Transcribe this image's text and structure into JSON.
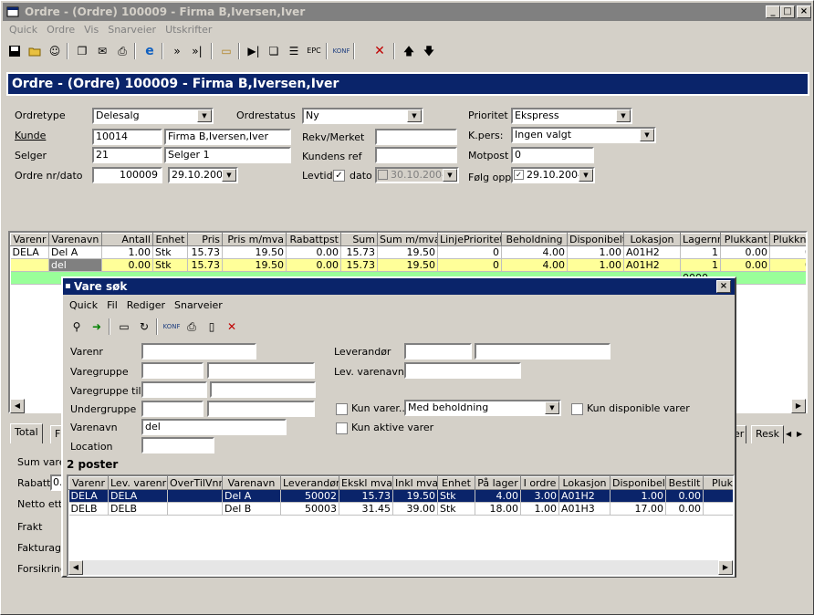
{
  "window": {
    "title": "Ordre -  (Ordre) 100009 - Firma B,Iversen,Iver",
    "banner": "Ordre -  (Ordre) 100009 - Firma B,Iversen,Iver",
    "caption_buttons": [
      "_",
      "□",
      "×"
    ]
  },
  "menu": [
    "Quick",
    "Ordre",
    "Vis",
    "Snarveier",
    "Utskrifter"
  ],
  "form": {
    "ordretype_label": "Ordretype",
    "ordretype_value": "Delesalg",
    "ordrestatus_label": "Ordrestatus",
    "ordrestatus_value": "Ny",
    "prioritet_label": "Prioritet",
    "prioritet_value": "Ekspress",
    "kunde_label": "Kunde",
    "kunde_nr": "10014",
    "kunde_navn": "Firma B,Iversen,Iver",
    "rekv_label": "Rekv/Merket",
    "rekv_value": "",
    "kpers_label": "K.pers:",
    "kpers_value": "Ingen valgt",
    "selger_label": "Selger",
    "selger_nr": "21",
    "selger_navn": "Selger 1",
    "kundensref_label": "Kundens ref",
    "kundensref_value": "",
    "motpost_label": "Motpost",
    "motpost_value": "0",
    "ordrenr_label": "Ordre nr/dato",
    "ordrenr_value": "100009",
    "ordredato_value": "29.10.2004",
    "levtid_label": "Levtid",
    "dato_label": "dato",
    "levtid_dato": "30.10.2004",
    "folgopp_label": "Følg opp",
    "folgopp_dato": "29.10.2004"
  },
  "order_grid": {
    "columns": [
      "Varenr",
      "Varenavn",
      "Antall",
      "Enhet",
      "Pris",
      "Pris m/mva",
      "Rabattpst",
      "Sum",
      "Sum m/mva",
      "LinjePrioritet",
      "Beholdning",
      "Disponibelt",
      "Lokasjon",
      "Lagernr",
      "Plukkant",
      "Plukknr"
    ],
    "rows": [
      [
        "DELA",
        "Del A",
        "1.00",
        "Stk",
        "15.73",
        "19.50",
        "0.00",
        "15.73",
        "19.50",
        "0",
        "4.00",
        "1.00",
        "A01H2",
        "1",
        "0.00",
        "0"
      ],
      [
        "",
        "del",
        "0.00",
        "Stk",
        "15.73",
        "19.50",
        "0.00",
        "15.73",
        "19.50",
        "0",
        "4.00",
        "1.00",
        "A01H2",
        "1",
        "0.00",
        "0"
      ]
    ],
    "partial_value": "0000"
  },
  "bottom_tabs": [
    "Total",
    "F"
  ],
  "right_tabs": [
    "er",
    "Resk"
  ],
  "totals": {
    "sum_label": "Sum varel",
    "rabatt_label": "Rabatt",
    "rabatt_value": "0.",
    "netto_label": "Netto ette",
    "frakt_label": "Frakt",
    "faktura_label": "Fakturage",
    "forsikring_label": "Forsikring"
  },
  "dialog": {
    "title": "Vare søk",
    "menu": [
      "Quick",
      "Fil",
      "Rediger",
      "Snarveier"
    ],
    "varenr_label": "Varenr",
    "varenr_value": "",
    "varegruppe_label": "Varegruppe",
    "varegruppe_til_label": "Varegruppe til",
    "undergruppe_label": "Undergruppe",
    "varenavn_label": "Varenavn",
    "varenavn_value": "del",
    "location_label": "Location",
    "location_value": "",
    "leverandor_label": "Leverandør",
    "lev_varenavn_label": "Lev. varenavn",
    "kun_varer_label": "Kun varer...",
    "kun_varer_value": "Med beholdning",
    "kun_disponible_label": "Kun disponible varer",
    "kun_aktive_label": "Kun aktive varer",
    "count_text": "2 poster",
    "columns": [
      "Varenr",
      "Lev. varenr",
      "OverTilVnr",
      "Varenavn",
      "Leverandør",
      "Ekskl mva",
      "Inkl mva",
      "Enhet",
      "På lager",
      "I ordre",
      "Lokasjon",
      "Disponibelt",
      "Bestilt",
      "Plukl"
    ],
    "rows": [
      [
        "DELA",
        "DELA",
        "",
        "Del A",
        "50002",
        "15.73",
        "19.50",
        "Stk",
        "4.00",
        "3.00",
        "A01H2",
        "1.00",
        "0.00",
        ""
      ],
      [
        "DELB",
        "DELB",
        "",
        "Del B",
        "50003",
        "31.45",
        "39.00",
        "Stk",
        "18.00",
        "1.00",
        "A01H3",
        "17.00",
        "0.00",
        ""
      ]
    ]
  },
  "colors": {
    "title_active": "#0a246a",
    "row_yellow": "#ffff99",
    "row_green": "#99ff99",
    "selection": "#0a246a"
  }
}
